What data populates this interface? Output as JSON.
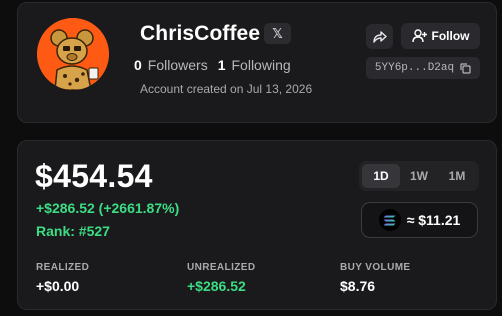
{
  "profile": {
    "name": "ChrisCoffee",
    "x_badge": "𝕏",
    "followers_count": "0",
    "followers_label": "Followers",
    "following_count": "1",
    "following_label": "Following",
    "created": "Account created on Jul 13, 2026",
    "follow_label": "Follow",
    "address": "5YY6p...D2aq"
  },
  "stats": {
    "value": "$454.54",
    "pnl": "+$286.52 (+2661.87%)",
    "rank": "Rank: #527",
    "timeframes": [
      "1D",
      "1W",
      "1M"
    ],
    "active_timeframe": "1D",
    "sol_balance": "≈ $11.21",
    "metrics": [
      {
        "label": "REALIZED",
        "value": "+$0.00"
      },
      {
        "label": "UNREALIZED",
        "value": "+$286.52"
      },
      {
        "label": "BUY VOLUME",
        "value": "$8.76"
      }
    ]
  },
  "colors": {
    "background": "#0d0d0e",
    "card": "#1a1a1c",
    "accent_green": "#3ddc84",
    "avatar_bg": "#ff5a14"
  }
}
